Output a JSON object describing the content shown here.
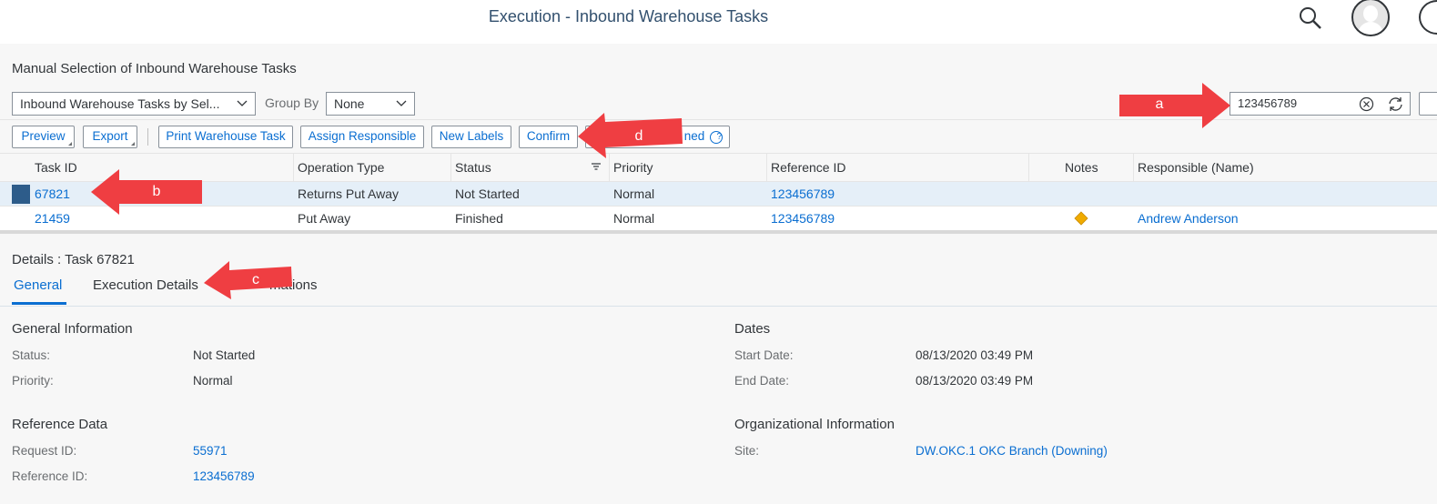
{
  "shell": {
    "title": "Execution - Inbound Warehouse Tasks"
  },
  "page": {
    "title": "Manual Selection of Inbound Warehouse Tasks"
  },
  "filters": {
    "variant": "Inbound Warehouse Tasks by Sel...",
    "group_by_label": "Group By",
    "group_by_value": "None",
    "search_value": "123456789"
  },
  "toolbar": {
    "preview": "Preview",
    "export": "Export",
    "print_task": "Print Warehouse Task",
    "assign_responsible": "Assign Responsible",
    "new_labels": "New Labels",
    "confirm": "Confirm",
    "partially_hidden": "ned"
  },
  "table": {
    "columns": [
      "Task ID",
      "Operation Type",
      "Status",
      "Priority",
      "Reference ID",
      "Notes",
      "Responsible (Name)"
    ],
    "rows": [
      {
        "task_id": "67821",
        "operation_type": "Returns Put Away",
        "status": "Not Started",
        "priority": "Normal",
        "reference_id": "123456789",
        "notes": "",
        "responsible": ""
      },
      {
        "task_id": "21459",
        "operation_type": "Put Away",
        "status": "Finished",
        "priority": "Normal",
        "reference_id": "123456789",
        "notes": "note-icon",
        "responsible": "Andrew Anderson"
      }
    ]
  },
  "details": {
    "title": "Details : Task 67821",
    "tabs": [
      "General",
      "Execution Details",
      "mations"
    ],
    "general_info": {
      "title": "General Information",
      "status_label": "Status:",
      "status_value": "Not Started",
      "priority_label": "Priority:",
      "priority_value": "Normal"
    },
    "dates": {
      "title": "Dates",
      "start_label": "Start Date:",
      "start_value": "08/13/2020 03:49 PM",
      "end_label": "End Date:",
      "end_value": "08/13/2020 03:49 PM"
    },
    "reference_data": {
      "title": "Reference Data",
      "request_label": "Request ID:",
      "request_value": "55971",
      "reference_label": "Reference ID:",
      "reference_value": "123456789"
    },
    "org_info": {
      "title": "Organizational Information",
      "site_label": "Site:",
      "site_value": "DW.OKC.1 OKC Branch (Downing)"
    }
  },
  "callouts": {
    "a": "a",
    "b": "b",
    "c": "c",
    "d": "d"
  },
  "colors": {
    "accent": "#0a6ed1",
    "arrow": "#ef3e42",
    "selection": "#2d5c8a"
  }
}
